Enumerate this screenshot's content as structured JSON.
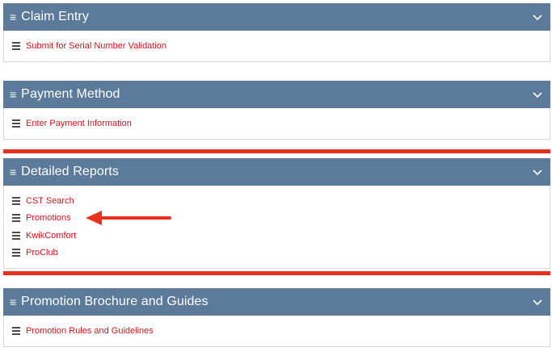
{
  "panels": [
    {
      "title": "Claim Entry",
      "items": [
        "Submit for Serial Number Validation"
      ]
    },
    {
      "title": "Payment Method",
      "items": [
        "Enter Payment Information"
      ]
    },
    {
      "title": "Detailed Reports",
      "items": [
        "CST Search",
        "Promotions",
        "KwikComfort",
        "ProClub"
      ]
    },
    {
      "title": "Promotion Brochure and Guides",
      "items": [
        "Promotion Rules and Guidelines"
      ]
    }
  ],
  "colors": {
    "header_bg": "#5c7a99",
    "link": "#d0121b",
    "highlight": "#e8301e"
  },
  "icons": {
    "header": "menu-icon",
    "item": "list-icon",
    "toggle": "chevron-down-icon",
    "annotation": "arrow-left-icon"
  }
}
